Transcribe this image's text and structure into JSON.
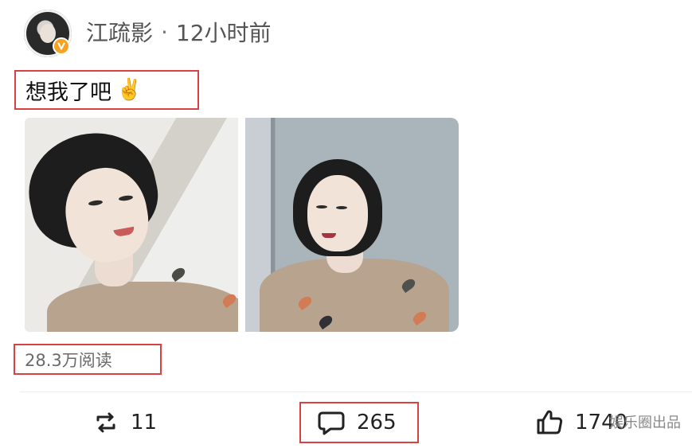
{
  "post": {
    "author_name": "江疏影",
    "separator": "·",
    "time": "12小时前",
    "text": "想我了吧",
    "emoji": "✌️",
    "views": "28.3万阅读",
    "images": [
      {
        "name": "portrait-left"
      },
      {
        "name": "portrait-right"
      }
    ]
  },
  "actions": {
    "repost_count": "11",
    "comment_count": "265",
    "like_count": "1740"
  },
  "overlay": {
    "watermark": "娱乐圈出品"
  },
  "icons": {
    "verified": "verified-v-icon",
    "repost": "repost-icon",
    "comment": "comment-icon",
    "like": "thumbs-up-icon"
  },
  "colors": {
    "highlight_box": "#d94242",
    "verified_badge": "#f6a323",
    "text_primary": "#222222",
    "text_secondary": "#6a6a6a"
  }
}
